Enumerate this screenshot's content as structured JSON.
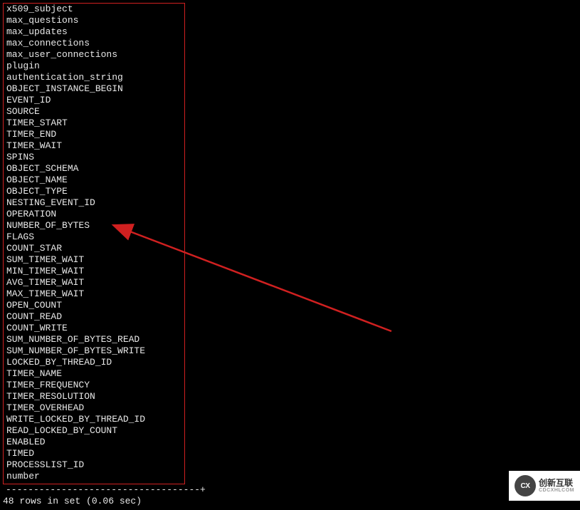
{
  "terminal": {
    "column_names": [
      "x509_subject",
      "max_questions",
      "max_updates",
      "max_connections",
      "max_user_connections",
      "plugin",
      "authentication_string",
      "OBJECT_INSTANCE_BEGIN",
      "EVENT_ID",
      "SOURCE",
      "TIMER_START",
      "TIMER_END",
      "TIMER_WAIT",
      "SPINS",
      "OBJECT_SCHEMA",
      "OBJECT_NAME",
      "OBJECT_TYPE",
      "NESTING_EVENT_ID",
      "OPERATION",
      "NUMBER_OF_BYTES",
      "FLAGS",
      "COUNT_STAR",
      "SUM_TIMER_WAIT",
      "MIN_TIMER_WAIT",
      "AVG_TIMER_WAIT",
      "MAX_TIMER_WAIT",
      "OPEN_COUNT",
      "COUNT_READ",
      "COUNT_WRITE",
      "SUM_NUMBER_OF_BYTES_READ",
      "SUM_NUMBER_OF_BYTES_WRITE",
      "LOCKED_BY_THREAD_ID",
      "TIMER_NAME",
      "TIMER_FREQUENCY",
      "TIMER_RESOLUTION",
      "TIMER_OVERHEAD",
      "WRITE_LOCKED_BY_THREAD_ID",
      "READ_LOCKED_BY_COUNT",
      "ENABLED",
      "TIMED",
      "PROCESSLIST_ID",
      "number"
    ],
    "table_suffix": "-----------------------------------+",
    "footer": "48 rows in set (0.06 sec)"
  },
  "watermark": {
    "logo_text": "CX",
    "brand": "创新互联",
    "sub": "CDCXHLCOM"
  },
  "annotation": {
    "arrow_color": "#d02020"
  }
}
